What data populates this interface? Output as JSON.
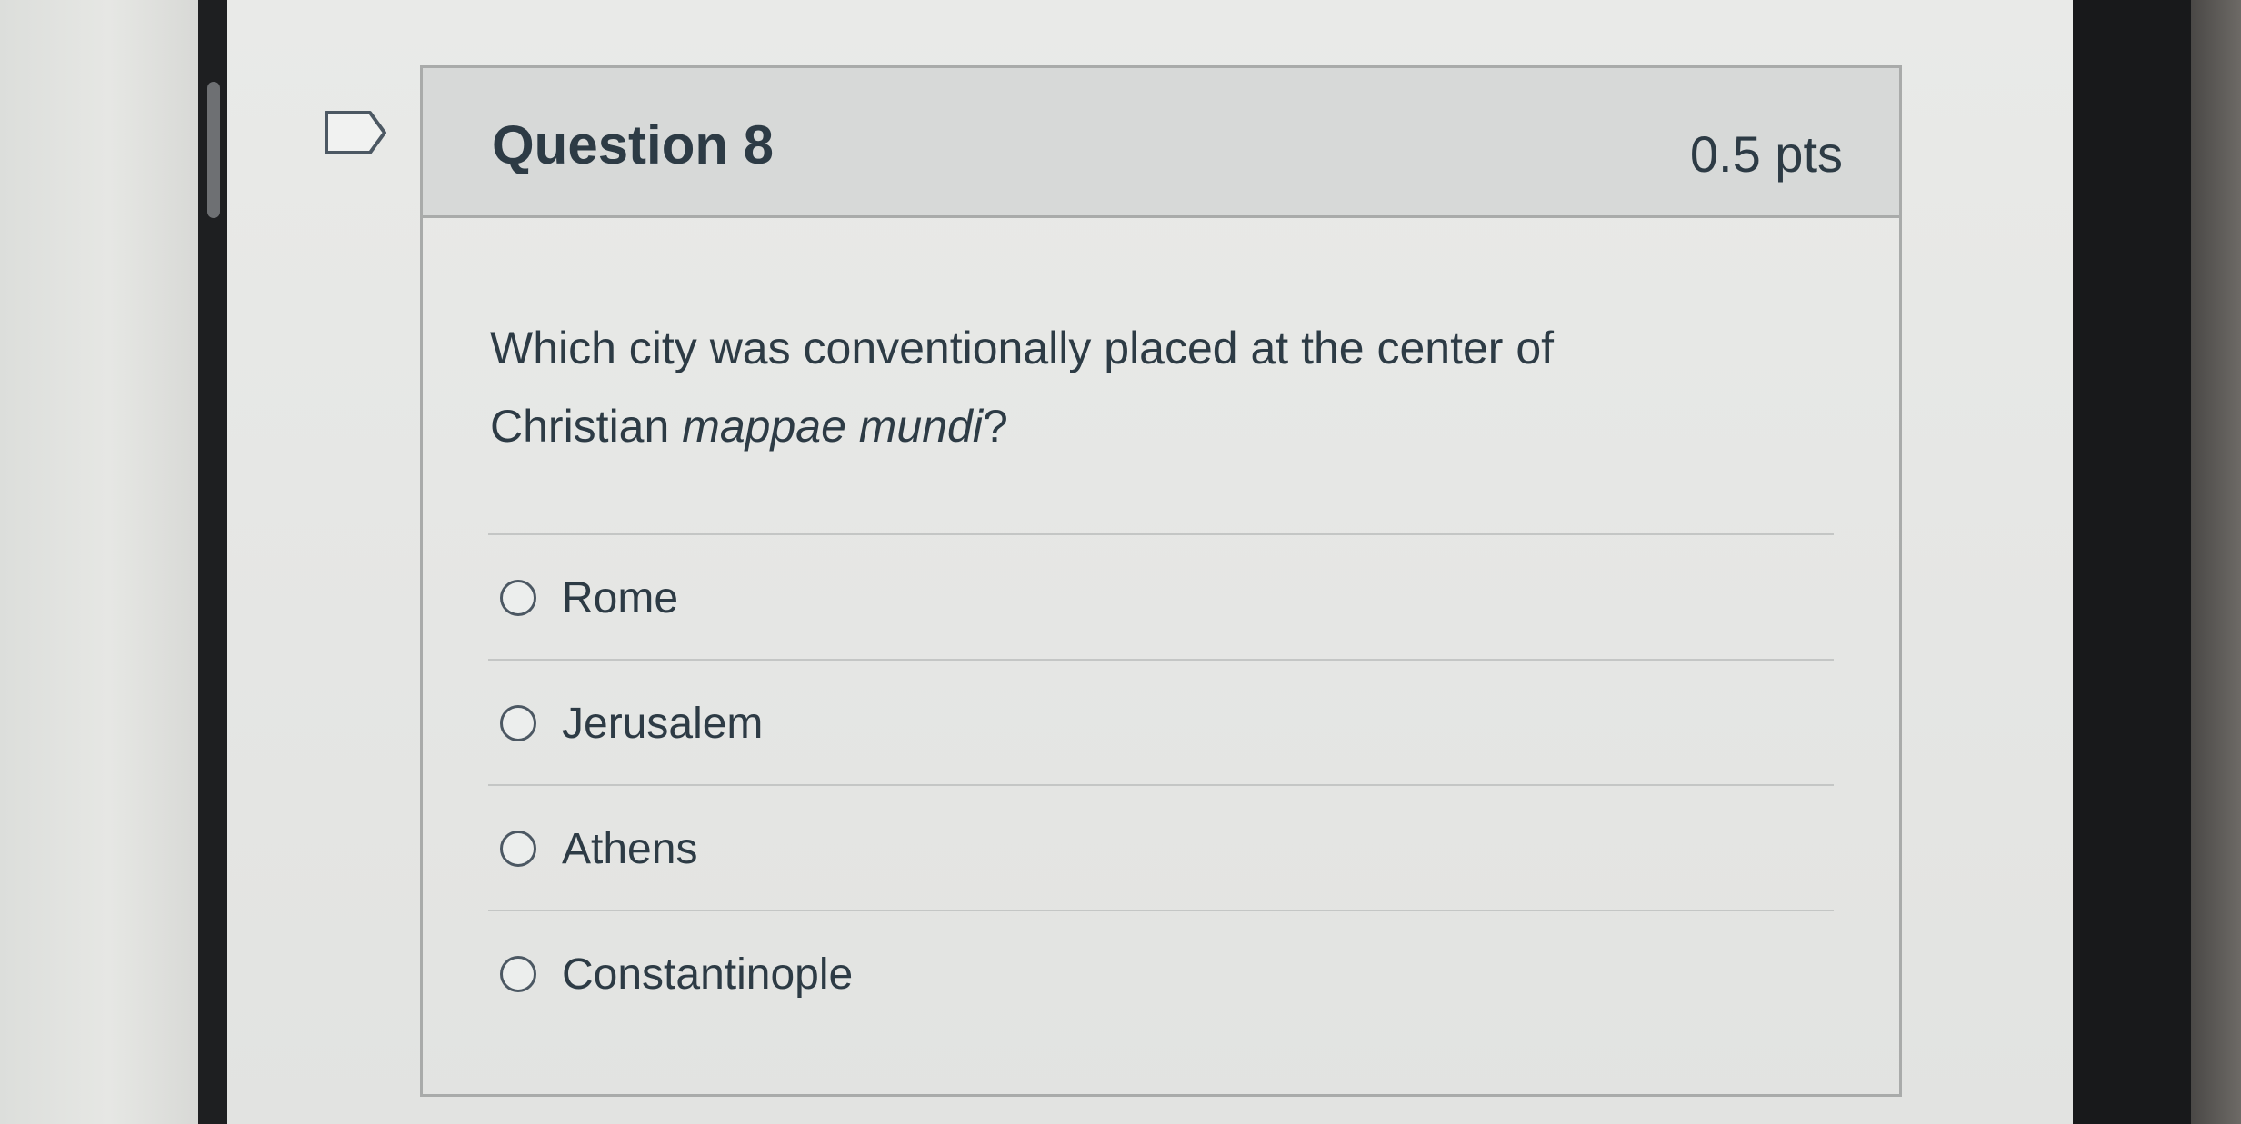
{
  "question": {
    "title": "Question 8",
    "points": "0.5 pts",
    "text_part1": "Which city was conventionally placed at the center of Christian ",
    "text_italic": "mappae mundi",
    "text_part2": "?"
  },
  "answers": [
    {
      "label": "Rome"
    },
    {
      "label": "Jerusalem"
    },
    {
      "label": "Athens"
    },
    {
      "label": "Constantinople"
    }
  ],
  "icons": {
    "flag": "flag-outline-icon",
    "radio": "radio-empty-icon"
  },
  "colors": {
    "text": "#2d3b45",
    "header_bg": "#d7d9d8",
    "border": "#a9abaa"
  }
}
